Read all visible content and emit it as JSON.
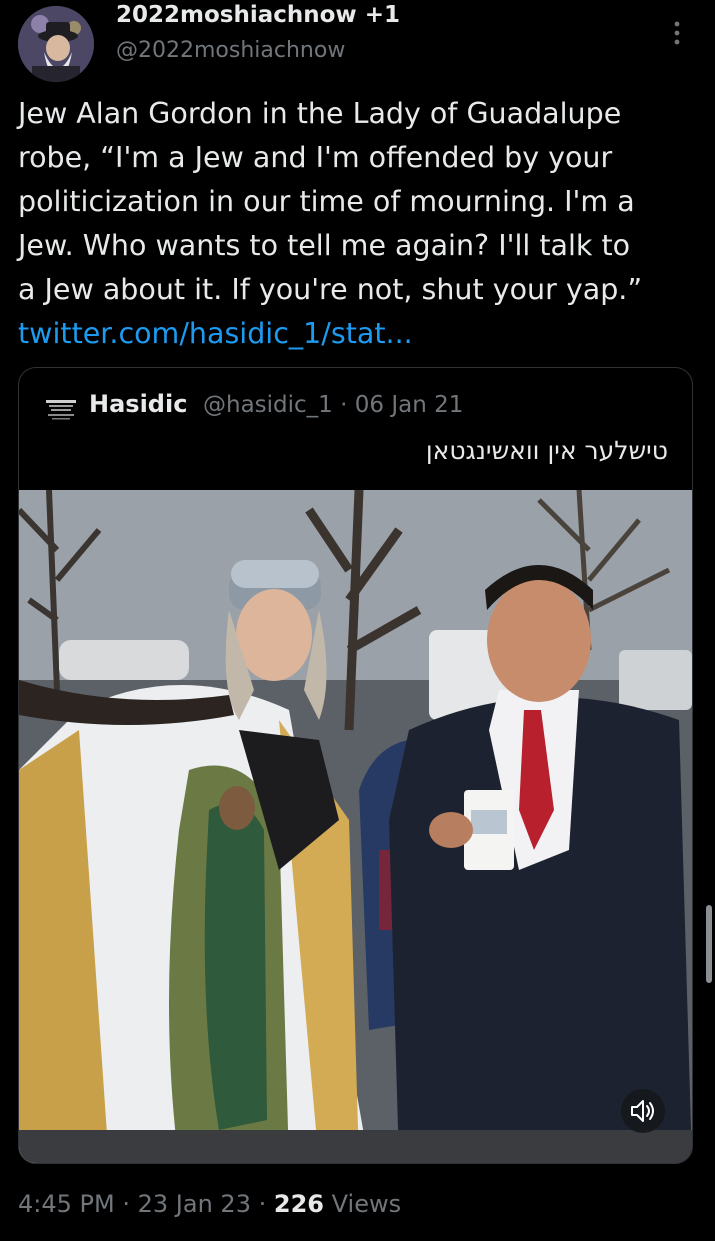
{
  "tweet": {
    "author_name": "2022moshiachnow +1",
    "author_handle": "@2022moshiachnow",
    "text": "Jew Alan Gordon in the Lady of Guadalupe\nrobe, “I'm a Jew and I'm offended by your\npoliticization in our time of mourning. I'm a\nJew. Who wants to tell me again? I'll talk to\na Jew about it. If you're not, shut your yap.”",
    "link_text": "twitter.com/hasidic_1/stat..."
  },
  "quoted_tweet": {
    "author_name": "Hasidic",
    "author_handle": "@hasidic_1",
    "separator": "·",
    "date": "06 Jan 21",
    "text": "טישלער אין וואשינגטאן"
  },
  "footer": {
    "time": "4:45 PM",
    "sep1": "·",
    "date": "23 Jan 23",
    "sep2": "·",
    "views_count": "226",
    "views_label": "Views"
  },
  "icons": {
    "more": "more-vertical-icon",
    "mute": "speaker-icon"
  },
  "colors": {
    "background": "#000000",
    "text_primary": "#e7e9ea",
    "text_secondary": "#71767b",
    "link": "#1d9bf0",
    "border": "#2f3336"
  }
}
